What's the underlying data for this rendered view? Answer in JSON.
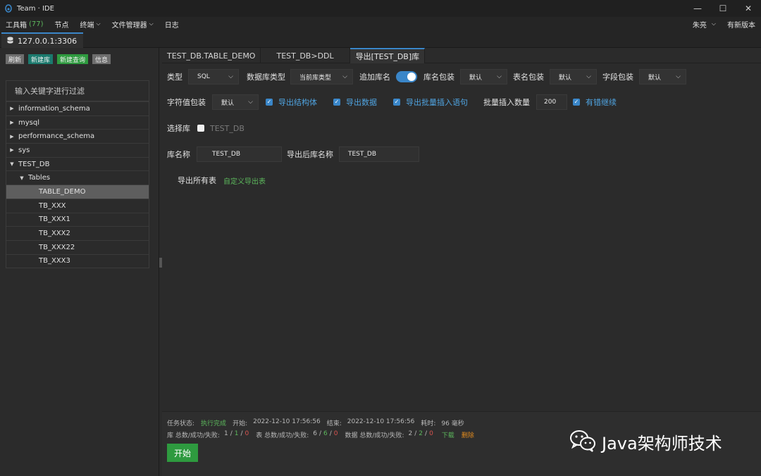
{
  "window": {
    "title": "Team · IDE",
    "controls": {
      "minimize": "—",
      "maximize": "☐",
      "close": "✕"
    }
  },
  "menu": {
    "toolbox_label": "工具箱",
    "toolbox_count": "(77)",
    "items": [
      "节点",
      "终端",
      "文件管理器",
      "日志"
    ],
    "user": "朱亮",
    "update": "有新版本"
  },
  "connection": {
    "label": "127.0.0.1:3306"
  },
  "sidebar": {
    "buttons": [
      "刷新",
      "新建库",
      "新建查询",
      "信息"
    ],
    "filter_placeholder": "输入关键字进行过滤",
    "tree": [
      {
        "label": "information_schema",
        "level": 0,
        "expanded": false
      },
      {
        "label": "mysql",
        "level": 0,
        "expanded": false
      },
      {
        "label": "performance_schema",
        "level": 0,
        "expanded": false
      },
      {
        "label": "sys",
        "level": 0,
        "expanded": false
      },
      {
        "label": "TEST_DB",
        "level": 0,
        "expanded": true
      },
      {
        "label": "Tables",
        "level": 1,
        "expanded": true
      },
      {
        "label": "TABLE_DEMO",
        "level": 2,
        "selected": true
      },
      {
        "label": "TB_XXX",
        "level": 2
      },
      {
        "label": "TB_XXX1",
        "level": 2
      },
      {
        "label": "TB_XXX2",
        "level": 2
      },
      {
        "label": "TB_XXX22",
        "level": 2
      },
      {
        "label": "TB_XXX3",
        "level": 2
      }
    ]
  },
  "tabs": [
    "TEST_DB.TABLE_DEMO",
    "TEST_DB>DDL",
    "导出[TEST_DB]库"
  ],
  "form": {
    "type_label": "类型",
    "type_value": "SQL",
    "dbtype_label": "数据库类型",
    "dbtype_value": "当前库类型",
    "append_db_label": "追加库名",
    "dbwrap_label": "库名包装",
    "dbwrap_value": "默认",
    "tablewrap_label": "表名包装",
    "tablewrap_value": "默认",
    "fieldwrap_label": "字段包装",
    "fieldwrap_value": "默认",
    "strwrap_label": "字符值包装",
    "strwrap_value": "默认",
    "export_struct": "导出结构体",
    "export_data": "导出数据",
    "export_batch": "导出批量插入语句",
    "batch_count_label": "批量插入数量",
    "batch_count_value": "200",
    "continue_on_error": "有错继续",
    "select_db_label": "选择库",
    "select_db_option": "TEST_DB",
    "dbname_label": "库名称",
    "dbname_value": "TEST_DB",
    "export_dbname_label": "导出后库名称",
    "export_dbname_value": "TEST_DB",
    "export_all_tables": "导出所有表",
    "custom_export_tables": "自定义导出表"
  },
  "status": {
    "task_label": "任务状态:",
    "task_value": "执行完成",
    "start_label": "开始:",
    "start_value": "2022-12-10 17:56:56",
    "end_label": "结束:",
    "end_value": "2022-12-10 17:56:56",
    "elapsed_label": "耗时:",
    "elapsed_value": "96 毫秒",
    "db_label": "库 总数/成功/失败:",
    "db_total": "1",
    "db_ok": "1",
    "db_fail": "0",
    "table_label": "表 总数/成功/失败:",
    "table_total": "6",
    "table_ok": "6",
    "table_fail": "0",
    "data_label": "数据 总数/成功/失败:",
    "data_total": "2",
    "data_ok": "2",
    "data_fail": "0",
    "download": "下载",
    "delete": "删除",
    "start_button": "开始"
  },
  "watermark": {
    "text": "Java架构师技术"
  }
}
